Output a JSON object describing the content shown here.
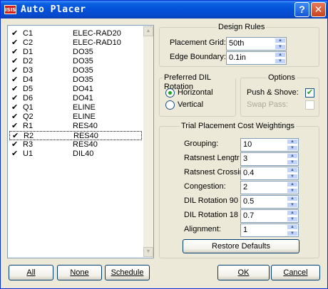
{
  "window": {
    "title": "Auto Placer",
    "app_icon_text": "ISIS",
    "help_glyph": "?",
    "close_glyph": "✕"
  },
  "components": [
    {
      "ref": "C1",
      "package": "ELEC-RAD20",
      "checked": true,
      "selected": false
    },
    {
      "ref": "C2",
      "package": "ELEC-RAD10",
      "checked": true,
      "selected": false
    },
    {
      "ref": "D1",
      "package": "DO35",
      "checked": true,
      "selected": false
    },
    {
      "ref": "D2",
      "package": "DO35",
      "checked": true,
      "selected": false
    },
    {
      "ref": "D3",
      "package": "DO35",
      "checked": true,
      "selected": false
    },
    {
      "ref": "D4",
      "package": "DO35",
      "checked": true,
      "selected": false
    },
    {
      "ref": "D5",
      "package": "DO41",
      "checked": true,
      "selected": false
    },
    {
      "ref": "D6",
      "package": "DO41",
      "checked": true,
      "selected": false
    },
    {
      "ref": "Q1",
      "package": "ELINE",
      "checked": true,
      "selected": false
    },
    {
      "ref": "Q2",
      "package": "ELINE",
      "checked": true,
      "selected": false
    },
    {
      "ref": "R1",
      "package": "RES40",
      "checked": true,
      "selected": false
    },
    {
      "ref": "R2",
      "package": "RES40",
      "checked": true,
      "selected": true
    },
    {
      "ref": "R3",
      "package": "RES40",
      "checked": true,
      "selected": false
    },
    {
      "ref": "U1",
      "package": "DIL40",
      "checked": true,
      "selected": false
    }
  ],
  "check_glyph": "✔",
  "design_rules": {
    "legend": "Design Rules",
    "placement_grid_label": "Placement Grid:",
    "placement_grid_value": "50th",
    "edge_boundary_label": "Edge Boundary:",
    "edge_boundary_value": "0.1in"
  },
  "dil_rotation": {
    "legend": "Preferred DIL Rotation",
    "horizontal_label": "Horizontal",
    "vertical_label": "Vertical",
    "selected": "Horizontal"
  },
  "options": {
    "legend": "Options",
    "push_shove_label": "Push & Shove:",
    "push_shove_checked": true,
    "swap_pass_label": "Swap Pass:",
    "swap_pass_checked": false,
    "swap_pass_enabled": false
  },
  "weightings": {
    "legend": "Trial Placement Cost Weightings",
    "items": [
      {
        "label": "Grouping:",
        "value": "10"
      },
      {
        "label": "Ratsnest Lengtr",
        "value": "3"
      },
      {
        "label": "Ratsnest Crossir",
        "value": "0.4"
      },
      {
        "label": "Congestion:",
        "value": "2"
      },
      {
        "label": "DIL Rotation 90",
        "value": "0.5"
      },
      {
        "label": "DIL Rotation 18",
        "value": "0.7"
      },
      {
        "label": "Alignment:",
        "value": "1"
      }
    ],
    "restore_label": "Restore Defaults"
  },
  "buttons": {
    "all": "All",
    "none": "None",
    "schedule": "Schedule",
    "ok": "OK",
    "cancel": "Cancel"
  }
}
